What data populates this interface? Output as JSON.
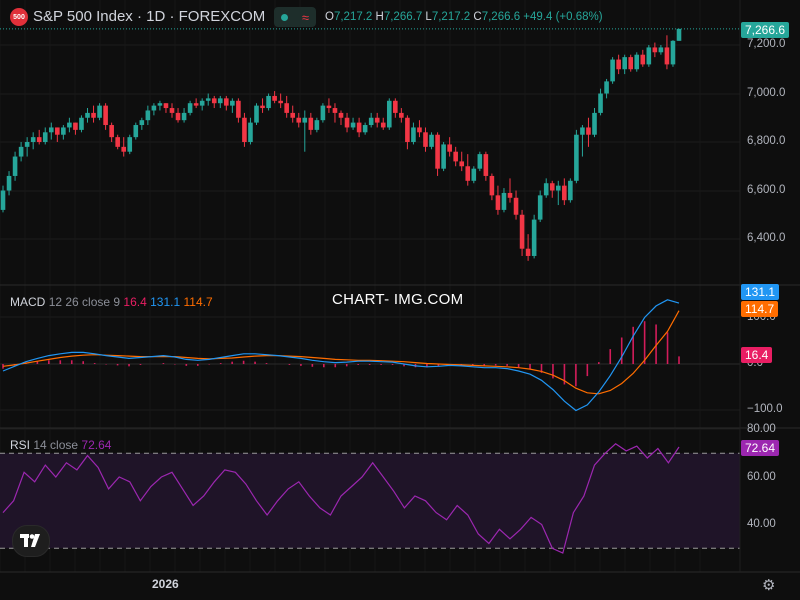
{
  "header": {
    "badge": "500",
    "title": "S&P 500 Index · 1D · FOREXCOM",
    "ohlc": {
      "o_key": "O",
      "o_val": "7,217.2",
      "h_key": "H",
      "h_val": "7,266.7",
      "l_key": "L",
      "l_val": "7,217.2",
      "c_key": "C",
      "c_val": "7,266.6",
      "change": "+49.4 (+0.68%)"
    }
  },
  "watermark": "CHART- IMG.COM",
  "macd": {
    "name": "MACD",
    "params": "12 26 close 9",
    "hist_label": "16.4",
    "macd_label": "131.1",
    "signal_label": "114.7"
  },
  "rsi": {
    "name": "RSI",
    "params": "14 close",
    "value_label": "72.64"
  },
  "price_axis": {
    "last_price_tag": "7,266.6",
    "ticks": [
      "7,200.0",
      "7,000.0",
      "6,800.0",
      "6,600.0",
      "6,400.0"
    ]
  },
  "macd_axis": {
    "ticks": [
      "100.0",
      "0.0",
      "−100.0"
    ],
    "tags": {
      "macd": "131.1",
      "signal": "114.7",
      "hist": "16.4"
    }
  },
  "rsi_axis": {
    "ticks": [
      "80.00",
      "60.00",
      "40.00"
    ],
    "tag": "72.64"
  },
  "time_axis": {
    "label": "2026"
  },
  "colors": {
    "up": "#26a69a",
    "down": "#f23645",
    "macd_line": "#2196f3",
    "signal_line": "#ff6d00",
    "hist": "#e91e63",
    "rsi_line": "#9c27b0",
    "rsi_band": "#1f1428",
    "background": "#0e0e0e"
  },
  "icons": [
    "tradingview-logo-icon",
    "settings-gear-icon"
  ],
  "chart_data": [
    {
      "type": "candlestick",
      "title": "S&P 500 Index · 1D · FOREXCOM",
      "ylim": [
        6300,
        7300
      ],
      "last": 7266.6,
      "ohlc": [
        [
          6520,
          6620,
          6510,
          6600
        ],
        [
          6600,
          6680,
          6580,
          6660
        ],
        [
          6660,
          6760,
          6640,
          6740
        ],
        [
          6740,
          6800,
          6720,
          6780
        ],
        [
          6780,
          6820,
          6740,
          6800
        ],
        [
          6800,
          6840,
          6770,
          6820
        ],
        [
          6820,
          6850,
          6790,
          6800
        ],
        [
          6800,
          6860,
          6790,
          6840
        ],
        [
          6840,
          6880,
          6810,
          6860
        ],
        [
          6860,
          6860,
          6800,
          6830
        ],
        [
          6830,
          6870,
          6810,
          6860
        ],
        [
          6860,
          6900,
          6840,
          6880
        ],
        [
          6880,
          6880,
          6830,
          6850
        ],
        [
          6850,
          6910,
          6840,
          6900
        ],
        [
          6900,
          6940,
          6880,
          6920
        ],
        [
          6920,
          6950,
          6880,
          6900
        ],
        [
          6900,
          6960,
          6890,
          6950
        ],
        [
          6950,
          6960,
          6850,
          6870
        ],
        [
          6870,
          6880,
          6800,
          6820
        ],
        [
          6820,
          6830,
          6770,
          6780
        ],
        [
          6780,
          6820,
          6740,
          6760
        ],
        [
          6760,
          6830,
          6750,
          6820
        ],
        [
          6820,
          6880,
          6810,
          6870
        ],
        [
          6870,
          6900,
          6850,
          6890
        ],
        [
          6890,
          6950,
          6870,
          6930
        ],
        [
          6930,
          6960,
          6910,
          6950
        ],
        [
          6950,
          6970,
          6930,
          6960
        ],
        [
          6960,
          6960,
          6920,
          6940
        ],
        [
          6940,
          6960,
          6900,
          6920
        ],
        [
          6920,
          6940,
          6880,
          6890
        ],
        [
          6890,
          6940,
          6880,
          6920
        ],
        [
          6920,
          6970,
          6910,
          6960
        ],
        [
          6960,
          6980,
          6940,
          6950
        ],
        [
          6950,
          6980,
          6930,
          6970
        ],
        [
          6970,
          7000,
          6950,
          6980
        ],
        [
          6980,
          6990,
          6940,
          6960
        ],
        [
          6960,
          6990,
          6940,
          6980
        ],
        [
          6980,
          6990,
          6930,
          6950
        ],
        [
          6950,
          6980,
          6920,
          6970
        ],
        [
          6970,
          6980,
          6880,
          6900
        ],
        [
          6900,
          6920,
          6780,
          6800
        ],
        [
          6800,
          6900,
          6790,
          6880
        ],
        [
          6880,
          6960,
          6870,
          6950
        ],
        [
          6950,
          6980,
          6920,
          6940
        ],
        [
          6940,
          7000,
          6930,
          6990
        ],
        [
          6990,
          7010,
          6960,
          6970
        ],
        [
          6970,
          7000,
          6940,
          6960
        ],
        [
          6960,
          6990,
          6900,
          6920
        ],
        [
          6920,
          6950,
          6880,
          6900
        ],
        [
          6900,
          6920,
          6860,
          6880
        ],
        [
          6880,
          6930,
          6760,
          6900
        ],
        [
          6900,
          6920,
          6830,
          6850
        ],
        [
          6850,
          6900,
          6840,
          6890
        ],
        [
          6890,
          6960,
          6880,
          6950
        ],
        [
          6950,
          6980,
          6920,
          6940
        ],
        [
          6940,
          6960,
          6880,
          6920
        ],
        [
          6920,
          6930,
          6870,
          6900
        ],
        [
          6900,
          6920,
          6840,
          6860
        ],
        [
          6860,
          6900,
          6850,
          6880
        ],
        [
          6880,
          6900,
          6820,
          6840
        ],
        [
          6840,
          6880,
          6830,
          6870
        ],
        [
          6870,
          6920,
          6860,
          6900
        ],
        [
          6900,
          6920,
          6860,
          6880
        ],
        [
          6880,
          6900,
          6850,
          6860
        ],
        [
          6860,
          6980,
          6850,
          6970
        ],
        [
          6970,
          6980,
          6900,
          6920
        ],
        [
          6920,
          6940,
          6880,
          6900
        ],
        [
          6900,
          6910,
          6770,
          6800
        ],
        [
          6800,
          6880,
          6790,
          6860
        ],
        [
          6860,
          6890,
          6820,
          6840
        ],
        [
          6840,
          6860,
          6760,
          6780
        ],
        [
          6780,
          6840,
          6770,
          6830
        ],
        [
          6830,
          6840,
          6660,
          6690
        ],
        [
          6690,
          6800,
          6680,
          6790
        ],
        [
          6790,
          6820,
          6740,
          6760
        ],
        [
          6760,
          6780,
          6700,
          6720
        ],
        [
          6720,
          6760,
          6680,
          6700
        ],
        [
          6700,
          6750,
          6620,
          6640
        ],
        [
          6640,
          6700,
          6630,
          6690
        ],
        [
          6690,
          6760,
          6680,
          6750
        ],
        [
          6750,
          6760,
          6640,
          6660
        ],
        [
          6660,
          6670,
          6560,
          6580
        ],
        [
          6580,
          6620,
          6500,
          6520
        ],
        [
          6520,
          6610,
          6510,
          6590
        ],
        [
          6590,
          6650,
          6550,
          6570
        ],
        [
          6570,
          6600,
          6480,
          6500
        ],
        [
          6500,
          6520,
          6330,
          6360
        ],
        [
          6360,
          6420,
          6310,
          6330
        ],
        [
          6330,
          6500,
          6320,
          6480
        ],
        [
          6480,
          6600,
          6470,
          6580
        ],
        [
          6580,
          6650,
          6570,
          6630
        ],
        [
          6630,
          6640,
          6570,
          6600
        ],
        [
          6600,
          6640,
          6540,
          6620
        ],
        [
          6620,
          6650,
          6540,
          6560
        ],
        [
          6560,
          6650,
          6550,
          6640
        ],
        [
          6640,
          6850,
          6630,
          6830
        ],
        [
          6830,
          6870,
          6740,
          6860
        ],
        [
          6860,
          6900,
          6780,
          6830
        ],
        [
          6830,
          6940,
          6820,
          6920
        ],
        [
          6920,
          7020,
          6910,
          7000
        ],
        [
          7000,
          7060,
          6980,
          7050
        ],
        [
          7050,
          7150,
          7040,
          7140
        ],
        [
          7140,
          7160,
          7080,
          7100
        ],
        [
          7100,
          7160,
          7080,
          7150
        ],
        [
          7150,
          7160,
          7090,
          7100
        ],
        [
          7100,
          7170,
          7090,
          7160
        ],
        [
          7160,
          7180,
          7110,
          7120
        ],
        [
          7120,
          7200,
          7110,
          7190
        ],
        [
          7190,
          7210,
          7150,
          7170
        ],
        [
          7170,
          7200,
          7160,
          7190
        ],
        [
          7190,
          7240,
          7100,
          7120
        ],
        [
          7120,
          7220,
          7110,
          7217.2
        ],
        [
          7217.2,
          7266.7,
          7217.2,
          7266.6
        ]
      ]
    },
    {
      "type": "line",
      "title": "MACD 12 26 close 9",
      "ylim": [
        -110,
        170
      ],
      "series": [
        {
          "name": "MACD",
          "values": [
            -15,
            -5,
            5,
            12,
            18,
            22,
            25,
            25,
            22,
            18,
            15,
            12,
            14,
            16,
            18,
            15,
            10,
            8,
            10,
            14,
            18,
            22,
            22,
            20,
            18,
            15,
            12,
            8,
            5,
            3,
            4,
            6,
            6,
            5,
            4,
            0,
            -4,
            -6,
            -5,
            -3,
            -4,
            -6,
            -8,
            -8,
            -10,
            -15,
            -22,
            -35,
            -55,
            -80,
            -100,
            -88,
            -60,
            -25,
            15,
            60,
            100,
            125,
            138,
            131
          ]
        },
        {
          "name": "Signal",
          "values": [
            -5,
            -2,
            2,
            6,
            10,
            14,
            17,
            19,
            20,
            19,
            18,
            17,
            16,
            16,
            16,
            16,
            14,
            12,
            11,
            12,
            13,
            15,
            17,
            18,
            18,
            17,
            16,
            14,
            12,
            10,
            9,
            8,
            8,
            7,
            6,
            5,
            3,
            1,
            0,
            -1,
            -2,
            -3,
            -4,
            -5,
            -6,
            -8,
            -11,
            -16,
            -24,
            -36,
            -52,
            -62,
            -64,
            -57,
            -42,
            -20,
            8,
            40,
            70,
            114.7
          ]
        },
        {
          "name": "Histogram",
          "values": [
            -10,
            -3,
            3,
            6,
            8,
            8,
            8,
            6,
            2,
            -1,
            -3,
            -5,
            -2,
            0,
            2,
            -1,
            -4,
            -4,
            -1,
            2,
            5,
            7,
            5,
            2,
            0,
            -2,
            -4,
            -6,
            -7,
            -7,
            -5,
            -2,
            -2,
            -2,
            -2,
            -5,
            -7,
            -7,
            -5,
            -2,
            -2,
            -3,
            -4,
            -3,
            -4,
            -7,
            -11,
            -19,
            -31,
            -44,
            -48,
            -26,
            4,
            32,
            57,
            80,
            92,
            85,
            68,
            16.4
          ]
        }
      ]
    },
    {
      "type": "line",
      "title": "RSI 14 close",
      "ylim": [
        27,
        80
      ],
      "bands": [
        30,
        70
      ],
      "series": [
        {
          "name": "RSI",
          "values": [
            45,
            50,
            62,
            58,
            65,
            60,
            66,
            63,
            69,
            64,
            55,
            60,
            58,
            50,
            56,
            60,
            62,
            55,
            48,
            52,
            58,
            63,
            62,
            57,
            50,
            44,
            50,
            55,
            58,
            52,
            47,
            44,
            52,
            56,
            60,
            66,
            60,
            54,
            47,
            52,
            50,
            45,
            42,
            48,
            44,
            36,
            32,
            38,
            34,
            38,
            43,
            40,
            30,
            28,
            45,
            52,
            65,
            70,
            74,
            71,
            73,
            68,
            72,
            66,
            72.64
          ]
        }
      ]
    }
  ]
}
